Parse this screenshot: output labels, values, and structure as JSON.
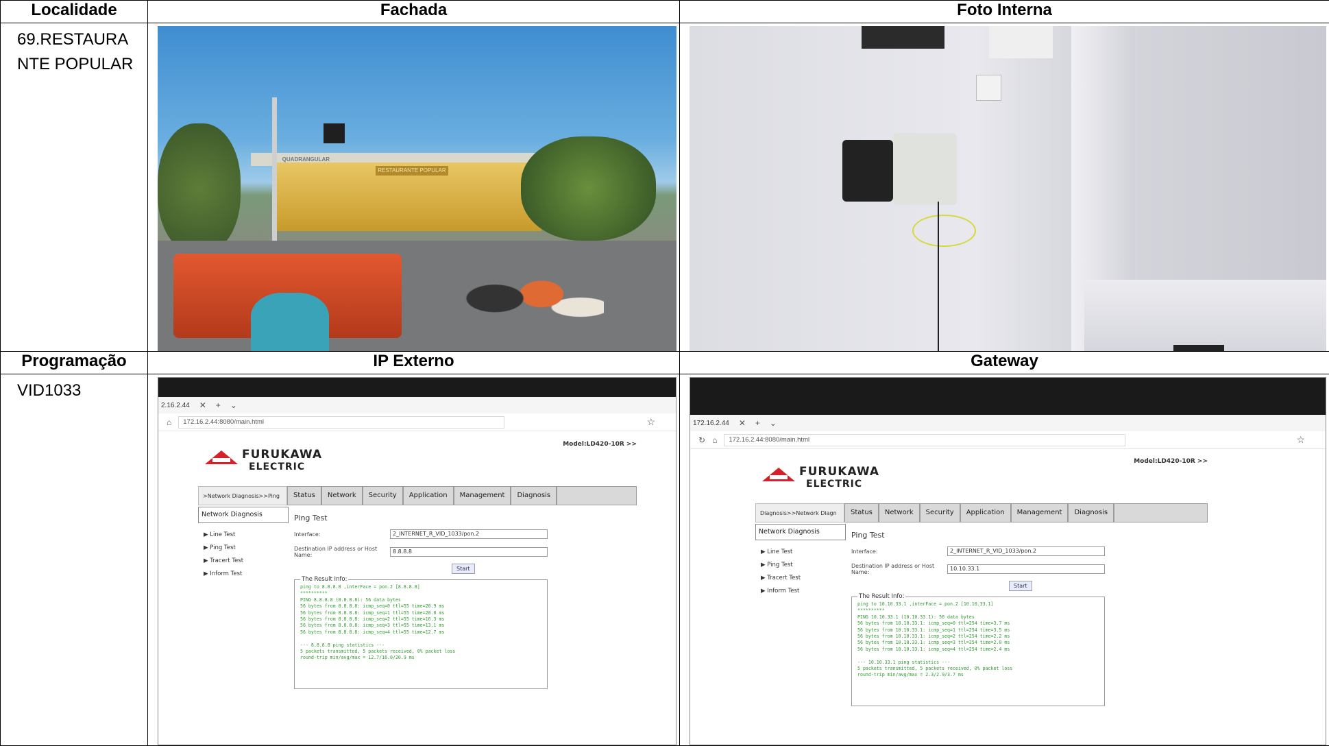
{
  "headers": {
    "locality": "Localidade",
    "facade": "Fachada",
    "internal_photo": "Foto Interna",
    "programming": "Programação",
    "external_ip": "IP Externo",
    "gateway": "Gateway"
  },
  "locality_value_line1": "69.RESTAURA",
  "locality_value_line2": "NTE POPULAR",
  "programming_value": "VID1033",
  "facade_sign_left": "QUADRANGULAR",
  "facade_sign_right": "RESTAURANTE POPULAR",
  "shot_ip": {
    "tab": "2.16.2.44",
    "url": "172.16.2.44:8080/main.html",
    "model": "Model:LD420-10R  >>",
    "crumb": ">Network Diagnosis>>Ping",
    "menu": [
      "Status",
      "Network",
      "Security",
      "Application",
      "Management",
      "Diagnosis"
    ],
    "side_header": "Network Diagnosis",
    "side_items": [
      "▶  Line Test",
      "▶  Ping Test",
      "▶  Tracert Test",
      "▶  Inform Test"
    ],
    "title": "Ping Test",
    "interface_label": "Interface:",
    "interface_value": "2_INTERNET_R_VID_1033/pon.2",
    "dest_label": "Destination IP address or Host Name:",
    "dest_value": "8.8.8.8",
    "start": "Start",
    "result_legend": "The Result Info:",
    "result_text": "ping to 8.8.8.8 ,interFace = pon.2 [8.8.8.8]\n**********\nPING 8.8.8.8 (8.8.8.8): 56 data bytes\n56 bytes from 8.8.8.8: icmp_seq=0 ttl=55 time=20.9 ms\n56 bytes from 8.8.8.8: icmp_seq=1 ttl=55 time=20.0 ms\n56 bytes from 8.8.8.8: icmp_seq=2 ttl=55 time=16.3 ms\n56 bytes from 8.8.8.8: icmp_seq=3 ttl=55 time=13.1 ms\n56 bytes from 8.8.8.8: icmp_seq=4 ttl=55 time=12.7 ms\n\n--- 8.8.8.8 ping statistics ---\n5 packets transmitted, 5 packets received, 0% packet loss\nround-trip min/avg/max = 12.7/16.0/20.9 ms"
  },
  "shot_gw": {
    "tab": "172.16.2.44",
    "url": "172.16.2.44:8080/main.html",
    "model": "Model:LD420-10R  >>",
    "crumb": "Diagnosis>>Network Diagn",
    "menu": [
      "Status",
      "Network",
      "Security",
      "Application",
      "Management",
      "Diagnosis"
    ],
    "side_header": "Network Diagnosis",
    "side_items": [
      "▶  Line Test",
      "▶  Ping Test",
      "▶  Tracert Test",
      "▶  Inform Test"
    ],
    "title": "Ping Test",
    "interface_label": "Interface:",
    "interface_value": "2_INTERNET_R_VID_1033/pon.2",
    "dest_label": "Destination IP address or Host Name:",
    "dest_value": "10.10.33.1",
    "start": "Start",
    "result_legend": "The Result Info:",
    "result_text": "ping to 10.10.33.1 ,interFace = pon.2 [10.10.33.1]\n**********\nPING 10.10.33.1 (10.10.33.1): 56 data bytes\n56 bytes from 10.10.33.1: icmp_seq=0 ttl=254 time=3.7 ms\n56 bytes from 10.10.33.1: icmp_seq=1 ttl=254 time=3.5 ms\n56 bytes from 10.10.33.1: icmp_seq=2 ttl=254 time=2.2 ms\n56 bytes from 10.10.33.1: icmp_seq=3 ttl=254 time=2.0 ms\n56 bytes from 10.10.33.1: icmp_seq=4 ttl=254 time=2.4 ms\n\n--- 10.10.33.1 ping statistics ---\n5 packets transmitted, 5 packets received, 0% packet loss\nround-trip min/avg/max = 2.3/2.9/3.7 ms"
  },
  "logo": {
    "line1": "FURUKAWA",
    "line2": "ELECTRIC"
  }
}
